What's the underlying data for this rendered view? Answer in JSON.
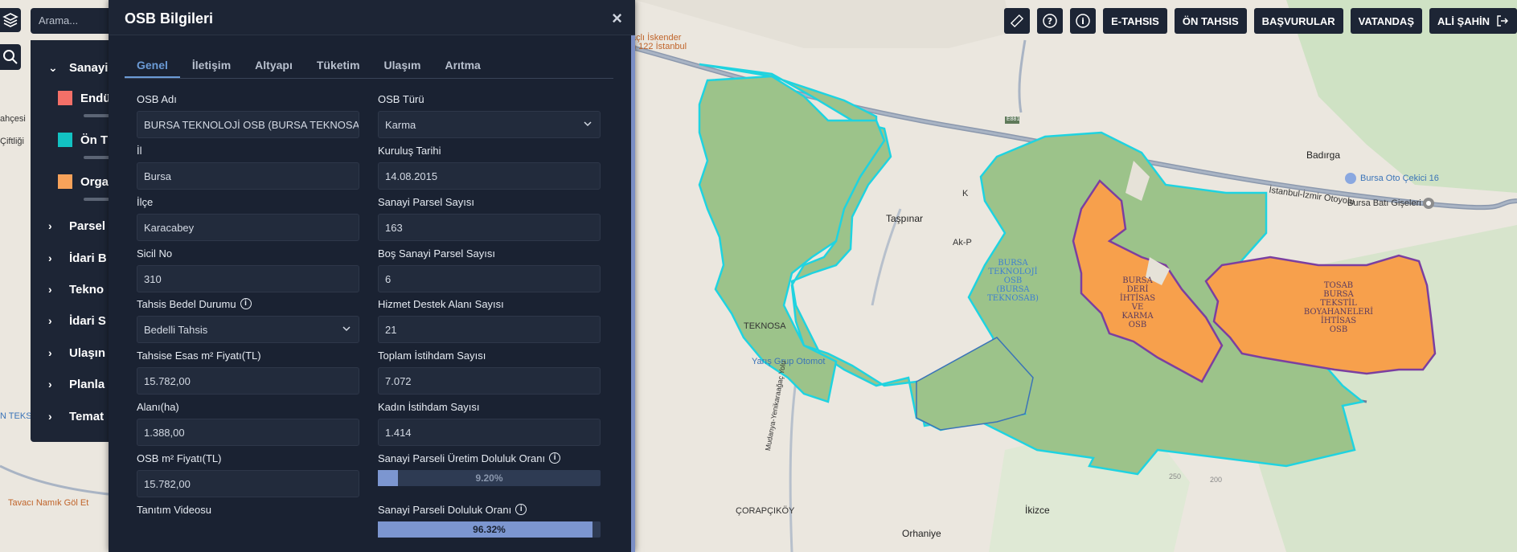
{
  "search": {
    "placeholder": "Arama..."
  },
  "layers": {
    "groups": [
      {
        "label": "Sanayi"
      },
      {
        "label": "Parsel"
      },
      {
        "label": "İdari B"
      },
      {
        "label": "Tekno"
      },
      {
        "label": "İdari S"
      },
      {
        "label": "Ulaşın"
      },
      {
        "label": "Planla"
      },
      {
        "label": "Temat"
      }
    ],
    "legend": [
      {
        "label": "Endü",
        "color": "#f47068"
      },
      {
        "label": "Ön T",
        "color": "#12c2c2"
      },
      {
        "label": "Orga",
        "color": "#f7a25a"
      }
    ]
  },
  "dialog": {
    "title": "OSB Bilgileri",
    "close": "×",
    "tabs": [
      "Genel",
      "İletişim",
      "Altyapı",
      "Tüketim",
      "Ulaşım",
      "Arıtma"
    ],
    "left": [
      {
        "label": "OSB Adı",
        "value": "BURSA TEKNOLOJİ OSB (BURSA TEKNOSAB)"
      },
      {
        "label": "İl",
        "value": "Bursa"
      },
      {
        "label": "İlçe",
        "value": "Karacabey"
      },
      {
        "label": "Sicil No",
        "value": "310"
      },
      {
        "label": "Tahsis Bedel Durumu",
        "value": "Bedelli Tahsis"
      },
      {
        "label": "Tahsise Esas m² Fiyatı(TL)",
        "value": "15.782,00"
      },
      {
        "label": "Alanı(ha)",
        "value": "1.388,00"
      },
      {
        "label": "OSB m² Fiyatı(TL)",
        "value": "15.782,00"
      },
      {
        "label": "Tanıtım Videosu"
      }
    ],
    "right": [
      {
        "label": "OSB Türü",
        "value": "Karma"
      },
      {
        "label": "Kuruluş Tarihi",
        "value": "14.08.2015"
      },
      {
        "label": "Sanayi Parsel Sayısı",
        "value": "163"
      },
      {
        "label": "Boş Sanayi Parsel Sayısı",
        "value": "6"
      },
      {
        "label": "Hizmet Destek Alanı Sayısı",
        "value": "21"
      },
      {
        "label": "Toplam İstihdam Sayısı",
        "value": "7.072"
      },
      {
        "label": "Kadın İstihdam Sayısı",
        "value": "1.414"
      },
      {
        "label": "Sanayi Parseli Üretim Doluluk Oranı",
        "value": "9.20%",
        "fraction": 0.092
      },
      {
        "label": "Sanayi Parseli Doluluk Oranı",
        "value": "96.32%",
        "fraction": 0.9632
      }
    ]
  },
  "toolbar": {
    "etahsis": "E-TAHSIS",
    "ontahsis": "ÖN TAHSIS",
    "basvurular": "BAŞVURULAR",
    "vatandas": "VATANDAŞ",
    "user": "ALİ ŞAHİN"
  },
  "map": {
    "labels": {
      "tavaci": "Tavacı Namık Göl Et",
      "ciftligi": "Çiftliği",
      "ahcesi": "ahçesi",
      "nteks": "N TEKS",
      "iskender": "açlı İskender",
      "istanbul122": "n 122 İstanbul",
      "taspinar": "Taşpınar",
      "akp": "Ak-P",
      "teknosa": "TEKNOSA",
      "yaris": "Yarış Grup Otomot",
      "corapcikoy": "ÇORAPÇIKÖY",
      "ikizce": "İkizce",
      "orhaniye": "Orhaniye",
      "badirga": "Badırga",
      "otocekici": "Bursa Oto Çekici 16",
      "istanbulizmir": "İstanbul-İzmir Otoyolu",
      "batigiseleri": "Bursa Batı Gişeleri",
      "mudanya": "Mudanya-Yenikaraağaç Yolu",
      "e881": "E881",
      "k": "K",
      "elev200": "200",
      "elev250": "250"
    },
    "polygons": {
      "teknosab": "BURSA\nTEKNOLOJİ\nOSB\n(BURSA\nTEKNOSAB)",
      "deri": "BURSA\nDERİ\nİHTİSAS\nVE\nKARMA\nOSB",
      "tosab": "TOSAB\nBURSA\nTEKSTİL\nBOYAHANELERİ\nİHTİSAS\nOSB"
    },
    "colors": {
      "green": "#9cc38a",
      "orange": "#f7a04c",
      "cyan": "#1fd3e0",
      "purple": "#7b3fa0"
    }
  }
}
